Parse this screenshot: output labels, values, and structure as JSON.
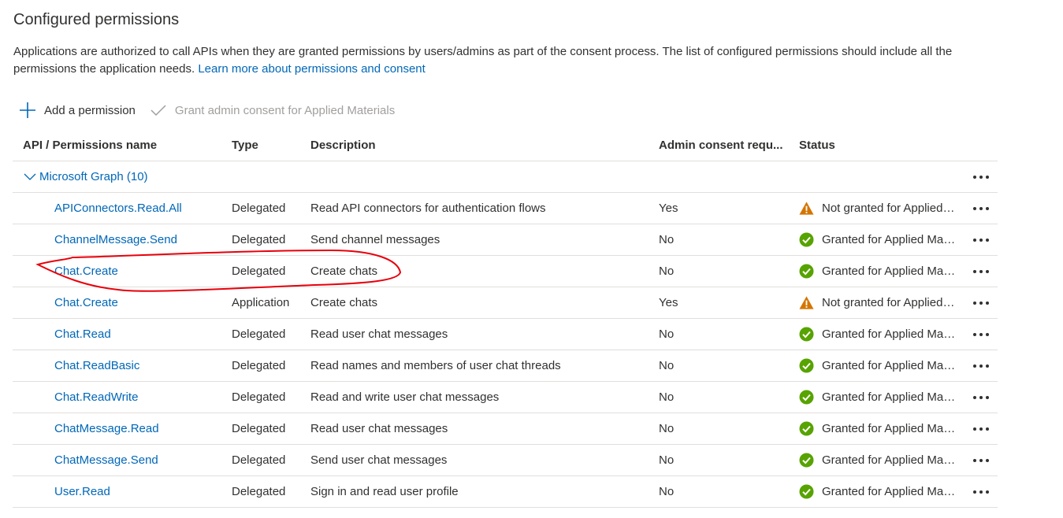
{
  "title": "Configured permissions",
  "description": {
    "text": "Applications are authorized to call APIs when they are granted permissions by users/admins as part of the consent process. The list of configured permissions should include all the permissions the application needs.",
    "link": "Learn more about permissions and consent"
  },
  "toolbar": {
    "add_permission": "Add a permission",
    "grant_admin_consent": "Grant admin consent for Applied Materials"
  },
  "table": {
    "columns": [
      "API / Permissions name",
      "Type",
      "Description",
      "Admin consent requ...",
      "Status"
    ],
    "group": {
      "name": "Microsoft Graph (10)"
    },
    "rows": [
      {
        "name": "APIConnectors.Read.All",
        "type": "Delegated",
        "description": "Read API connectors for authentication flows",
        "admin_consent": "Yes",
        "status": "Not granted for Applied Materials",
        "status_kind": "warning"
      },
      {
        "name": "ChannelMessage.Send",
        "type": "Delegated",
        "description": "Send channel messages",
        "admin_consent": "No",
        "status": "Granted for Applied Materials",
        "status_kind": "granted"
      },
      {
        "name": "Chat.Create",
        "type": "Delegated",
        "description": "Create chats",
        "admin_consent": "No",
        "status": "Granted for Applied Materials",
        "status_kind": "granted"
      },
      {
        "name": "Chat.Create",
        "type": "Application",
        "description": "Create chats",
        "admin_consent": "Yes",
        "status": "Not granted for Applied Materials",
        "status_kind": "warning"
      },
      {
        "name": "Chat.Read",
        "type": "Delegated",
        "description": "Read user chat messages",
        "admin_consent": "No",
        "status": "Granted for Applied Materials",
        "status_kind": "granted"
      },
      {
        "name": "Chat.ReadBasic",
        "type": "Delegated",
        "description": "Read names and members of user chat threads",
        "admin_consent": "No",
        "status": "Granted for Applied Materials",
        "status_kind": "granted"
      },
      {
        "name": "Chat.ReadWrite",
        "type": "Delegated",
        "description": "Read and write user chat messages",
        "admin_consent": "No",
        "status": "Granted for Applied Materials",
        "status_kind": "granted"
      },
      {
        "name": "ChatMessage.Read",
        "type": "Delegated",
        "description": "Read user chat messages",
        "admin_consent": "No",
        "status": "Granted for Applied Materials",
        "status_kind": "granted"
      },
      {
        "name": "ChatMessage.Send",
        "type": "Delegated",
        "description": "Send user chat messages",
        "admin_consent": "No",
        "status": "Granted for Applied Materials",
        "status_kind": "granted"
      },
      {
        "name": "User.Read",
        "type": "Delegated",
        "description": "Sign in and read user profile",
        "admin_consent": "No",
        "status": "Granted for Applied Materials",
        "status_kind": "granted"
      }
    ]
  },
  "icons": {
    "add": "plus-icon",
    "grant": "checkmark-icon",
    "expand": "chevron-down-icon",
    "granted": "check-circle-icon",
    "warning": "warning-triangle-icon",
    "more": "more-dots-icon"
  },
  "colors": {
    "link": "#0067b8",
    "granted": "#57a300",
    "warning": "#d47500",
    "annotation": "#e8000b"
  }
}
